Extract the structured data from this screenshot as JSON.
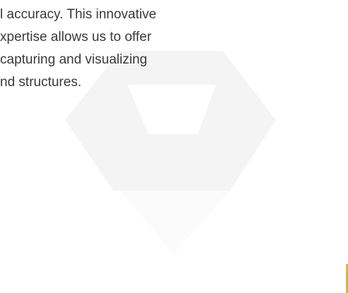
{
  "paragraph": {
    "lines": [
      "l accuracy. This innovative",
      "xpertise allows us to offer",
      "capturing  and  visualizing",
      "nd structures."
    ]
  },
  "colors": {
    "text": "#3a3a3a",
    "watermark": "#f4f4f4",
    "accent": "#d8b54a"
  },
  "icons": {
    "watermark": "hexagon-v-logo-icon"
  }
}
